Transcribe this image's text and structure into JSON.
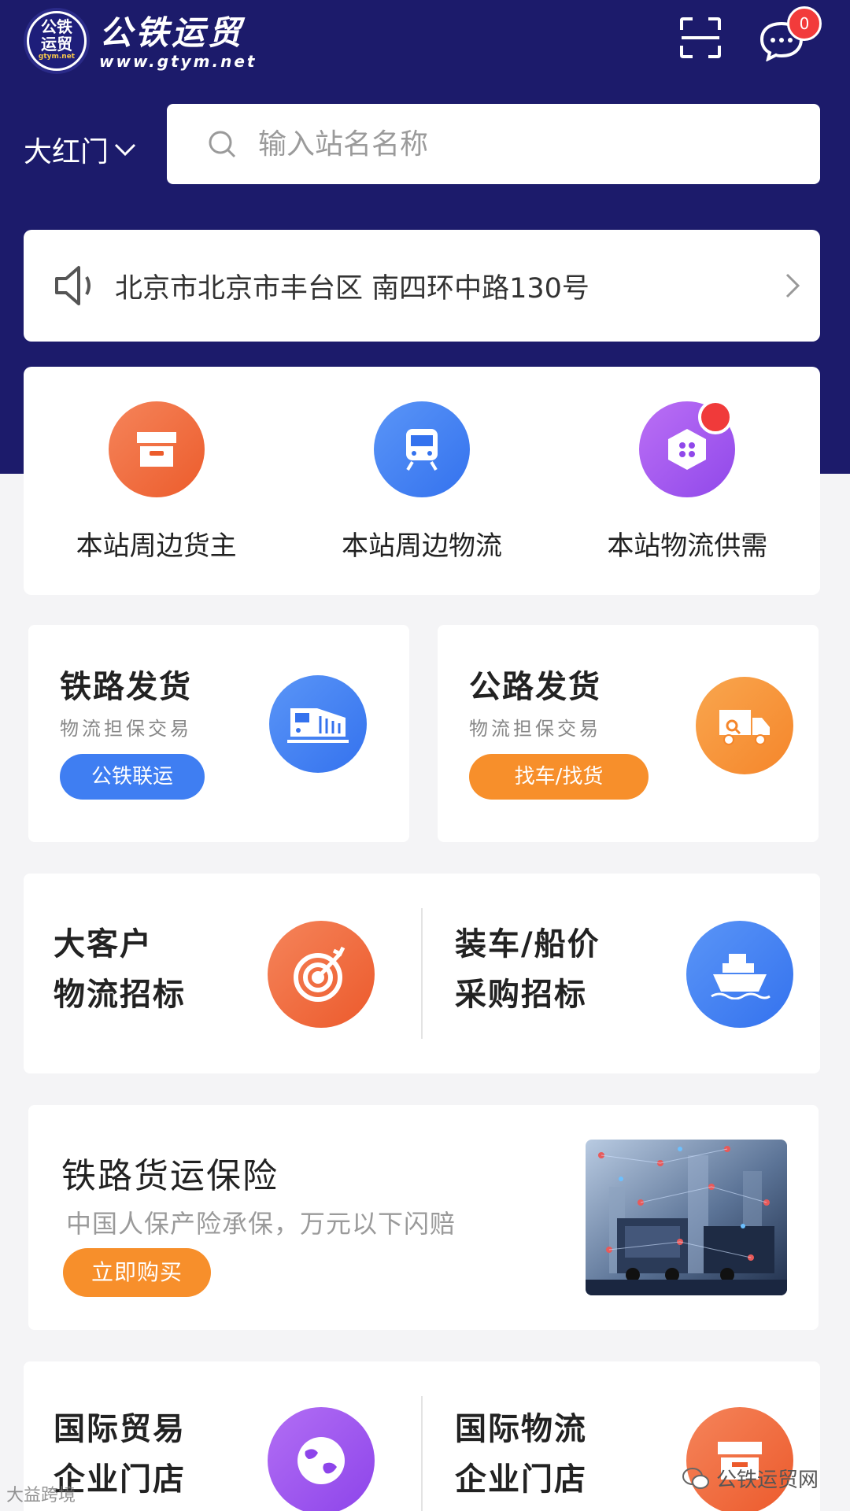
{
  "colors": {
    "header": "#1c1b6b",
    "blue": "#3f7ef2",
    "orange": "#f78f2b",
    "red_orange": "#f0673a",
    "purple": "#a45bf0"
  },
  "header": {
    "logo_text_line1": "公铁",
    "logo_text_line2": "运贸",
    "logo_subtext": "gtym.net",
    "brand_name": "公铁运贸",
    "brand_url": "www.gtym.net",
    "message_count": "0",
    "scan_icon": "scan-icon",
    "message_icon": "chat-bubble-icon"
  },
  "location": {
    "city": "大红门"
  },
  "search": {
    "placeholder": "输入站名名称",
    "value": ""
  },
  "notice": {
    "text": "北京市北京市丰台区 南四环中路130号",
    "icon": "speaker-icon"
  },
  "quick_links": [
    {
      "label": "本站周边货主",
      "icon": "storefront-icon",
      "color": "#f0673a"
    },
    {
      "label": "本站周边物流",
      "icon": "train-icon",
      "color": "#3f7ef2"
    },
    {
      "label": "本站物流供需",
      "icon": "hexagon-icon",
      "color": "#a45bf0"
    }
  ],
  "shipping": {
    "rail": {
      "title": "铁路发货",
      "subtitle": "物流担保交易",
      "button": "公铁联运",
      "icon": "train-icon"
    },
    "road": {
      "title": "公路发货",
      "subtitle": "物流担保交易",
      "button": "找车/找货",
      "icon": "truck-icon"
    }
  },
  "tenders": [
    {
      "line1": "大客户",
      "line2": "物流招标",
      "icon": "target-icon"
    },
    {
      "line1": "装车/船价",
      "line2": "采购招标",
      "icon": "ship-icon"
    }
  ],
  "insurance": {
    "title": "铁路货运保险",
    "subtitle": "中国人保产险承保，万元以下闪赔",
    "button": "立即购买"
  },
  "international": [
    {
      "line1": "国际贸易",
      "line2": "企业门店",
      "icon": "globe-icon"
    },
    {
      "line1": "国际物流",
      "line2": "企业门店",
      "icon": "store-icon"
    }
  ],
  "watermarks": {
    "right": "公铁运贸网",
    "left": "大益跨境"
  }
}
